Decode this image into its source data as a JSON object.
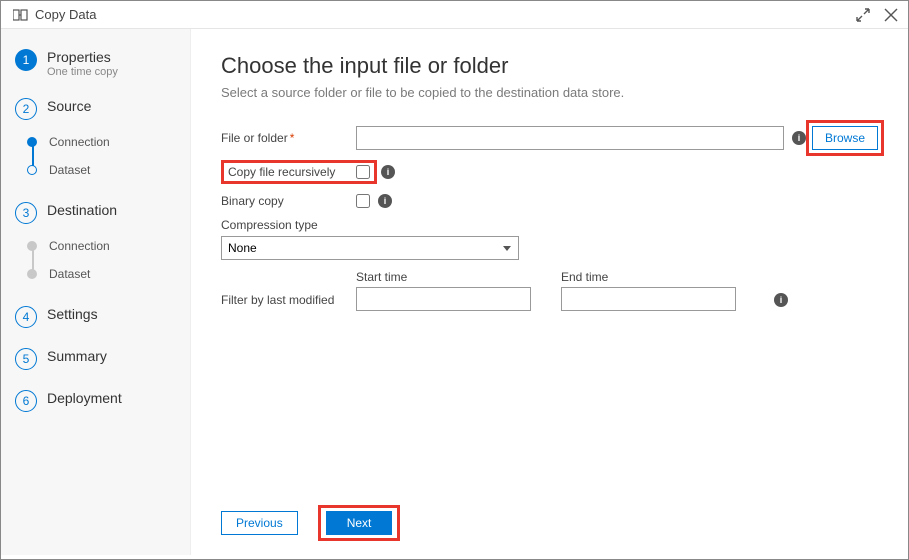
{
  "window": {
    "title": "Copy Data"
  },
  "sidebar": {
    "steps": [
      {
        "num": "1",
        "label": "Properties",
        "sub": "One time copy"
      },
      {
        "num": "2",
        "label": "Source"
      },
      {
        "num": "3",
        "label": "Destination"
      },
      {
        "num": "4",
        "label": "Settings"
      },
      {
        "num": "5",
        "label": "Summary"
      },
      {
        "num": "6",
        "label": "Deployment"
      }
    ],
    "source_substeps": [
      {
        "label": "Connection"
      },
      {
        "label": "Dataset"
      }
    ],
    "dest_substeps": [
      {
        "label": "Connection"
      },
      {
        "label": "Dataset"
      }
    ]
  },
  "main": {
    "heading": "Choose the input file or folder",
    "subtext": "Select a source folder or file to be copied to the destination data store.",
    "labels": {
      "file_or_folder": "File or folder",
      "copy_recursively": "Copy file recursively",
      "binary_copy": "Binary copy",
      "compression_type": "Compression type",
      "filter_last_modified": "Filter by last modified",
      "start_time": "Start time",
      "end_time": "End time"
    },
    "values": {
      "file_or_folder": "",
      "compression_type": "None",
      "start_time": "",
      "end_time": ""
    },
    "buttons": {
      "browse": "Browse",
      "previous": "Previous",
      "next": "Next"
    }
  }
}
